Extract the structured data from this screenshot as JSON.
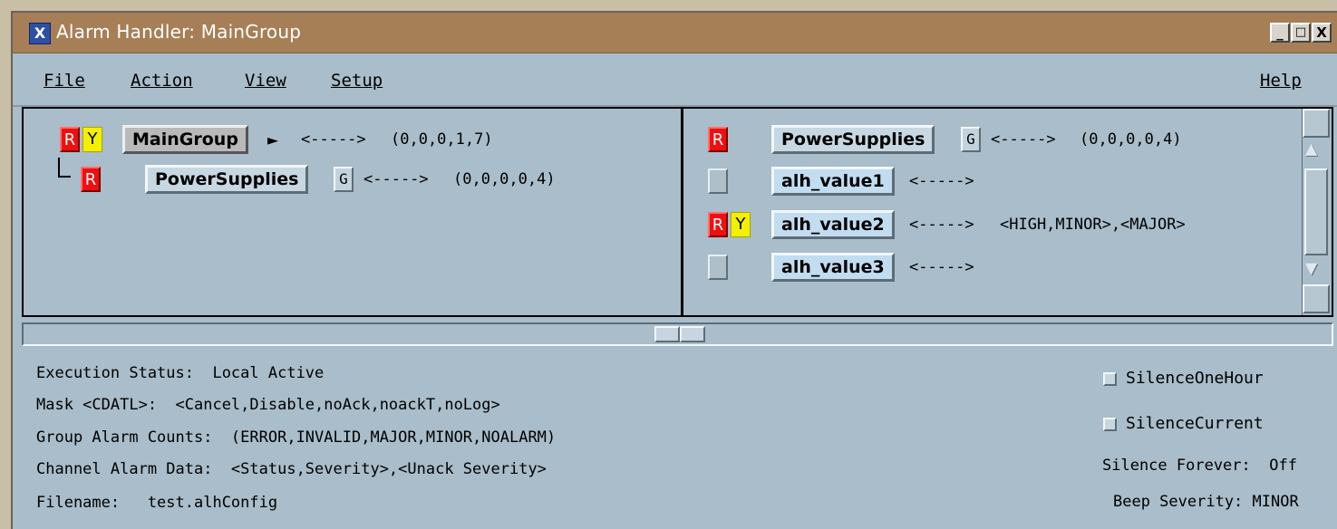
{
  "window": {
    "title": "Alarm Handler: MainGroup",
    "app_icon_letter": "X",
    "controls": {
      "minimize": "_",
      "maximize": "□",
      "close": "X"
    }
  },
  "menubar": {
    "file": "File",
    "action": "Action",
    "view": "View",
    "setup": "Setup",
    "help": "Help"
  },
  "tree_pane": {
    "main_group": {
      "badges": [
        "R",
        "Y"
      ],
      "name": "MainGroup",
      "arrow": "<----->",
      "counts": "(0,0,0,1,7)"
    },
    "power_supplies": {
      "badge": "R",
      "name": "PowerSupplies",
      "guidance": "G",
      "arrow": "<----->",
      "counts": "(0,0,0,0,4)"
    }
  },
  "channel_pane": {
    "group": {
      "badge": "R",
      "name": "PowerSupplies",
      "guidance": "G",
      "arrow": "<----->",
      "counts": "(0,0,0,0,4)"
    },
    "channels": [
      {
        "name": "alh_value1",
        "arrow": "<----->",
        "data": ""
      },
      {
        "name": "alh_value2",
        "badges": [
          "R",
          "Y"
        ],
        "arrow": "<----->",
        "data": "<HIGH,MINOR>,<MAJOR>"
      },
      {
        "name": "alh_value3",
        "arrow": "<----->",
        "data": ""
      }
    ]
  },
  "status": {
    "execution": "Execution Status:  Local Active",
    "mask": "Mask <CDATL>:  <Cancel,Disable,noAck,noackT,noLog>",
    "group_counts": "Group Alarm Counts:  (ERROR,INVALID,MAJOR,MINOR,NOALARM)",
    "channel_data": "Channel Alarm Data:  <Status,Severity>,<Unack Severity>",
    "filename": "Filename:   test.alhConfig"
  },
  "silence": {
    "one_hour": "SilenceOneHour",
    "current": "SilenceCurrent",
    "forever": "Silence Forever:  Off",
    "beep": "Beep Severity: MINOR"
  },
  "colors": {
    "titlebar": "#a67f56",
    "panel": "#a9bdca",
    "alarm_red": "#ee1010",
    "alarm_yellow": "#f4f000"
  }
}
